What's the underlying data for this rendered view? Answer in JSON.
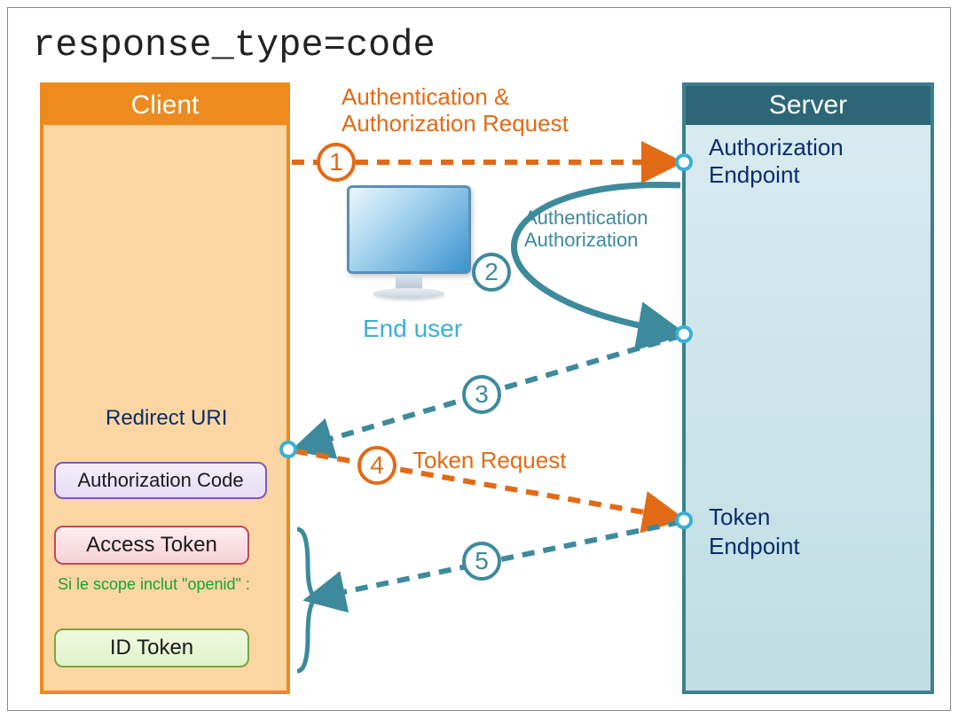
{
  "title": "response_type=code",
  "client": {
    "header": "Client",
    "redirect_label": "Redirect URI",
    "authcode": "Authorization Code",
    "access_token": "Access Token",
    "scope_note": "Si le scope inclut \"openid\" :",
    "id_token": "ID Token"
  },
  "server": {
    "header": "Server",
    "auth_endpoint": "Authorization Endpoint",
    "token_endpoint": "Token Endpoint"
  },
  "enduser": "End user",
  "steps": {
    "s1": "1",
    "s2": "2",
    "s3": "3",
    "s4": "4",
    "s5": "5"
  },
  "labels": {
    "step1": "Authentication & Authorization Request",
    "step2": "Authentication Authorization",
    "step4": "Token Request"
  },
  "colors": {
    "orange": "#e36a15",
    "teal": "#3d8a9c",
    "cyan": "#39b0d6"
  }
}
